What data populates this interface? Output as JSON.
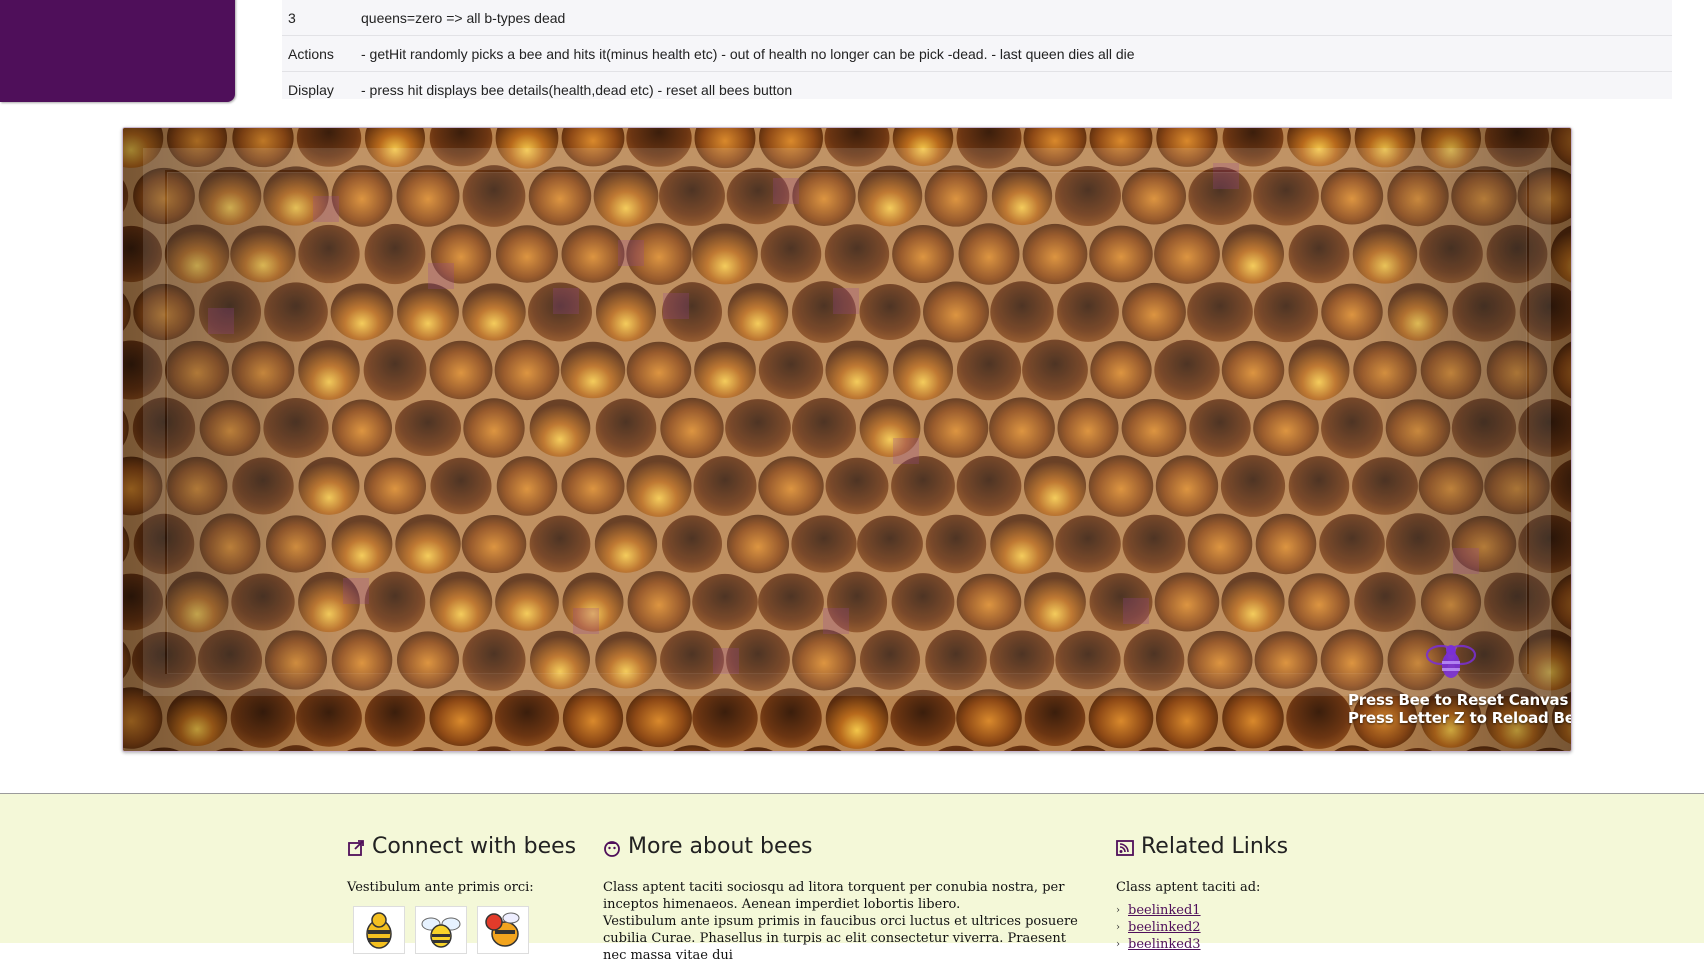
{
  "spec_rows": [
    {
      "key": "3",
      "value": "queens=zero => all b-types dead"
    },
    {
      "key": "Actions",
      "value": "- getHit randomly picks a bee and hits it(minus health etc) - out of health no longer can be pick -dead. - last queen dies all die"
    },
    {
      "key": "Display",
      "value": "- press hit displays bee details(health,dead etc) - reset all bees button"
    }
  ],
  "canvas": {
    "hint_line1": "Press Bee to Reset Canvas",
    "hint_line2": "Press Letter Z to Reload Bees"
  },
  "footer": {
    "connect": {
      "title": "Connect with bees",
      "text": "Vestibulum ante primis orci:"
    },
    "more": {
      "title": "More about bees",
      "text1": "Class aptent taciti sociosqu ad litora torquent per conubia nostra, per inceptos himenaeos. Aenean imperdiet lobortis libero.",
      "text2": "Vestibulum ante ipsum primis in faucibus orci luctus et ultrices posuere cubilia Curae. Phasellus in turpis ac elit consectetur viverra. Praesent nec massa vitae dui"
    },
    "related": {
      "title": "Related Links",
      "text": "Class aptent taciti ad:",
      "links": [
        "beelinked1",
        "beelinked2",
        "beelinked3"
      ]
    }
  },
  "colors": {
    "brand_purple": "#4f0f5a",
    "footer_bg": "#f4f8d8"
  }
}
